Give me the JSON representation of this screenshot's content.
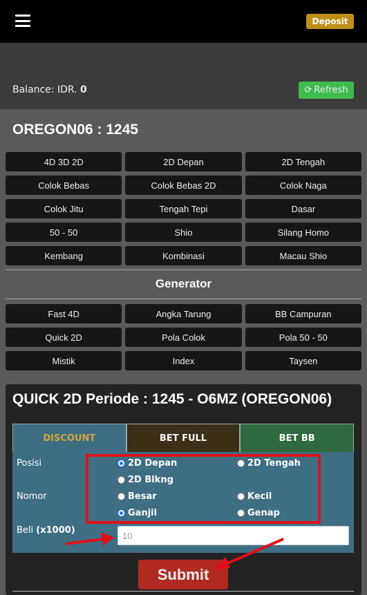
{
  "header": {
    "menu_icon": "hamburger-menu-icon",
    "deposit_label": "Deposit"
  },
  "balance": {
    "label": "Balance: IDR.",
    "value": "0",
    "refresh_icon": "refresh-icon",
    "refresh_label": "Refresh"
  },
  "market": {
    "title": "OREGON06 : 1245"
  },
  "games": [
    "4D 3D 2D",
    "2D Depan",
    "2D Tengah",
    "Colok Bebas",
    "Colok Bebas 2D",
    "Colok Naga",
    "Colok Jitu",
    "Tengah Tepi",
    "Dasar",
    "50 - 50",
    "Shio",
    "Silang Homo",
    "Kembang",
    "Kombinasi",
    "Macau Shio"
  ],
  "generator": {
    "title": "Generator",
    "items": [
      "Fast 4D",
      "Angka Tarung",
      "BB Campuran",
      "Quick 2D",
      "Pola Colok",
      "Pola 50 - 50",
      "Mistik",
      "Index",
      "Taysen"
    ]
  },
  "panel": {
    "title": "QUICK 2D Periode : 1245 - O6MZ (OREGON06)",
    "tabs": [
      "DISCOUNT",
      "BET FULL",
      "BET BB"
    ],
    "posisi_label": "Posisi",
    "nomor_label": "Nomor",
    "beli_label": "Beli",
    "beli_unit": "(x1000)",
    "posisi_options": [
      {
        "label": "2D Depan",
        "checked": true
      },
      {
        "label": "2D Tengah",
        "checked": false
      },
      {
        "label": "2D Blkng",
        "checked": false
      }
    ],
    "nomor_options": [
      {
        "label": "Besar",
        "checked": false
      },
      {
        "label": "Kecil",
        "checked": false
      },
      {
        "label": "Ganjil",
        "checked": true
      },
      {
        "label": "Genap",
        "checked": false
      }
    ],
    "beli_placeholder": "10",
    "submit_label": "Submit"
  },
  "colors": {
    "deposit": "#c08f1a",
    "refresh": "#3dbb4f",
    "form_bg": "#3e6e84",
    "submit": "#b02a22",
    "annotation": "#e0101a"
  }
}
